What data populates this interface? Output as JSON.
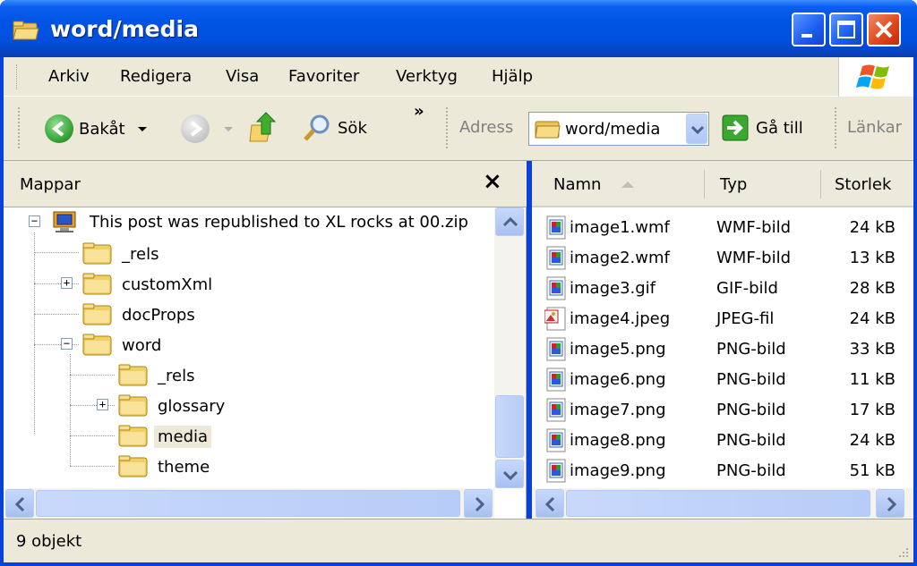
{
  "window": {
    "title": "word/media"
  },
  "menu": {
    "items": [
      "Arkiv",
      "Redigera",
      "Visa",
      "Favoriter",
      "Verktyg",
      "Hjälp"
    ]
  },
  "toolbar": {
    "back_label": "Bakåt",
    "search_label": "Sök",
    "more": "»",
    "address_label": "Adress",
    "address_value": "word/media",
    "goto_label": "Gå till",
    "links_label": "Länkar"
  },
  "folders": {
    "title": "Mappar",
    "close": "×",
    "tree": [
      {
        "label": "This post was republished to XL rocks at 00.zip",
        "expander": "−"
      },
      {
        "label": "_rels",
        "expander": ""
      },
      {
        "label": "customXml",
        "expander": "+"
      },
      {
        "label": "docProps",
        "expander": ""
      },
      {
        "label": "word",
        "expander": "−"
      },
      {
        "label": "_rels",
        "expander": ""
      },
      {
        "label": "glossary",
        "expander": "+"
      },
      {
        "label": "media",
        "expander": "",
        "selected": true
      },
      {
        "label": "theme",
        "expander": ""
      }
    ]
  },
  "files": {
    "columns": {
      "name": "Namn",
      "type": "Typ",
      "size": "Storlek"
    },
    "rows": [
      {
        "name": "image1.wmf",
        "type": "WMF-bild",
        "size": "24 kB",
        "icon": "image-file-icon"
      },
      {
        "name": "image2.wmf",
        "type": "WMF-bild",
        "size": "13 kB",
        "icon": "image-file-icon"
      },
      {
        "name": "image3.gif",
        "type": "GIF-bild",
        "size": "28 kB",
        "icon": "image-file-icon"
      },
      {
        "name": "image4.jpeg",
        "type": "JPEG-fil",
        "size": "24 kB",
        "icon": "jpeg-file-icon"
      },
      {
        "name": "image5.png",
        "type": "PNG-bild",
        "size": "33 kB",
        "icon": "image-file-icon"
      },
      {
        "name": "image6.png",
        "type": "PNG-bild",
        "size": "11 kB",
        "icon": "image-file-icon"
      },
      {
        "name": "image7.png",
        "type": "PNG-bild",
        "size": "17 kB",
        "icon": "image-file-icon"
      },
      {
        "name": "image8.png",
        "type": "PNG-bild",
        "size": "24 kB",
        "icon": "image-file-icon"
      },
      {
        "name": "image9.png",
        "type": "PNG-bild",
        "size": "51 kB",
        "icon": "image-file-icon"
      }
    ]
  },
  "status": {
    "text": "9 objekt"
  },
  "colors": {
    "titlebar": "#0054e3",
    "chrome": "#ece9d8",
    "close_button": "#e04a20"
  }
}
